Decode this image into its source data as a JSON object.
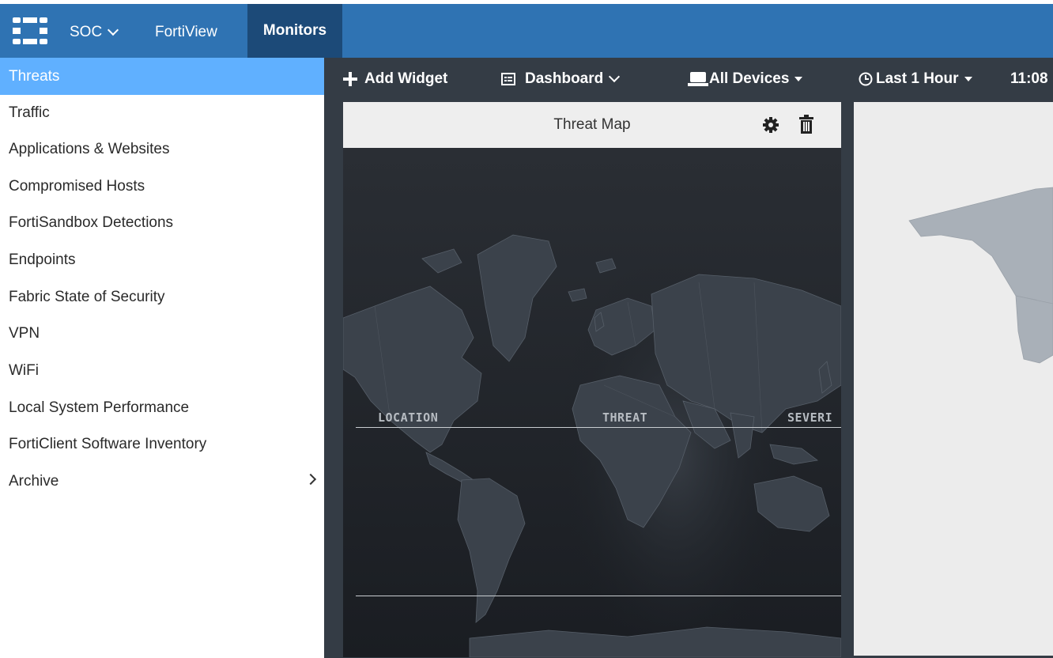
{
  "app": {
    "nav": {
      "soc": "SOC",
      "fortiview": "FortiView",
      "monitors": "Monitors"
    }
  },
  "sidebar": {
    "items": [
      {
        "label": "Threats",
        "active": true
      },
      {
        "label": "Traffic"
      },
      {
        "label": "Applications & Websites"
      },
      {
        "label": "Compromised Hosts"
      },
      {
        "label": "FortiSandbox Detections"
      },
      {
        "label": "Endpoints"
      },
      {
        "label": "Fabric State of Security"
      },
      {
        "label": "VPN"
      },
      {
        "label": "WiFi"
      },
      {
        "label": "Local System Performance"
      },
      {
        "label": "FortiClient Software Inventory"
      },
      {
        "label": "Archive",
        "has_submenu": true
      }
    ]
  },
  "toolbar": {
    "add_widget": "Add Widget",
    "dashboard": "Dashboard",
    "devices": "All Devices",
    "time_range": "Last 1 Hour",
    "clock": "11:08"
  },
  "widget": {
    "title": "Threat Map",
    "columns": [
      "LOCATION",
      "THREAT",
      "SEVERI"
    ]
  },
  "colors": {
    "topbar": "#2f73b3",
    "monitors_active": "#1c4a78",
    "sidebar_active": "#60b0ff",
    "main_bg": "#343c45",
    "map_bg": "#1d2126"
  },
  "icons": {
    "logo": "fortinet-logo-icon",
    "add": "plus-icon",
    "dashboard": "dashboard-icon",
    "devices": "device-icon",
    "time": "clock-icon",
    "settings": "gear-icon",
    "delete": "trash-icon"
  }
}
